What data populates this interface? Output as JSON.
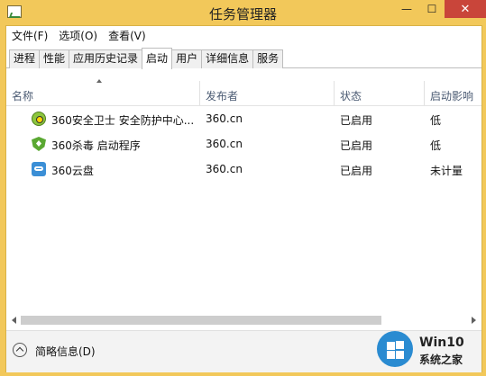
{
  "window": {
    "title": "任务管理器",
    "controls": [
      "—",
      "☐",
      "✕"
    ]
  },
  "menubar": [
    "文件(F)",
    "选项(O)",
    "查看(V)"
  ],
  "tabs": [
    {
      "label": "进程",
      "active": false
    },
    {
      "label": "性能",
      "active": false
    },
    {
      "label": "应用历史记录",
      "active": false
    },
    {
      "label": "启动",
      "active": true
    },
    {
      "label": "用户",
      "active": false
    },
    {
      "label": "详细信息",
      "active": false
    },
    {
      "label": "服务",
      "active": false
    }
  ],
  "columns": {
    "name": "名称",
    "publisher": "发布者",
    "status": "状态",
    "impact": "启动影响"
  },
  "rows": [
    {
      "icon": "360-safeguard-icon",
      "name": "360安全卫士 安全防护中心...",
      "publisher": "360.cn",
      "status": "已启用",
      "impact": "低"
    },
    {
      "icon": "360-antivirus-icon",
      "name": "360杀毒 启动程序",
      "publisher": "360.cn",
      "status": "已启用",
      "impact": "低"
    },
    {
      "icon": "360-cloud-icon",
      "name": "360云盘",
      "publisher": "360.cn",
      "status": "已启用",
      "impact": "未计量"
    }
  ],
  "footer": {
    "label": "简略信息(D)"
  },
  "watermark": {
    "name": "Win10",
    "sub": "系统之家"
  },
  "colors": {
    "titlebar": "#f2c85a",
    "close": "#c9453a"
  }
}
